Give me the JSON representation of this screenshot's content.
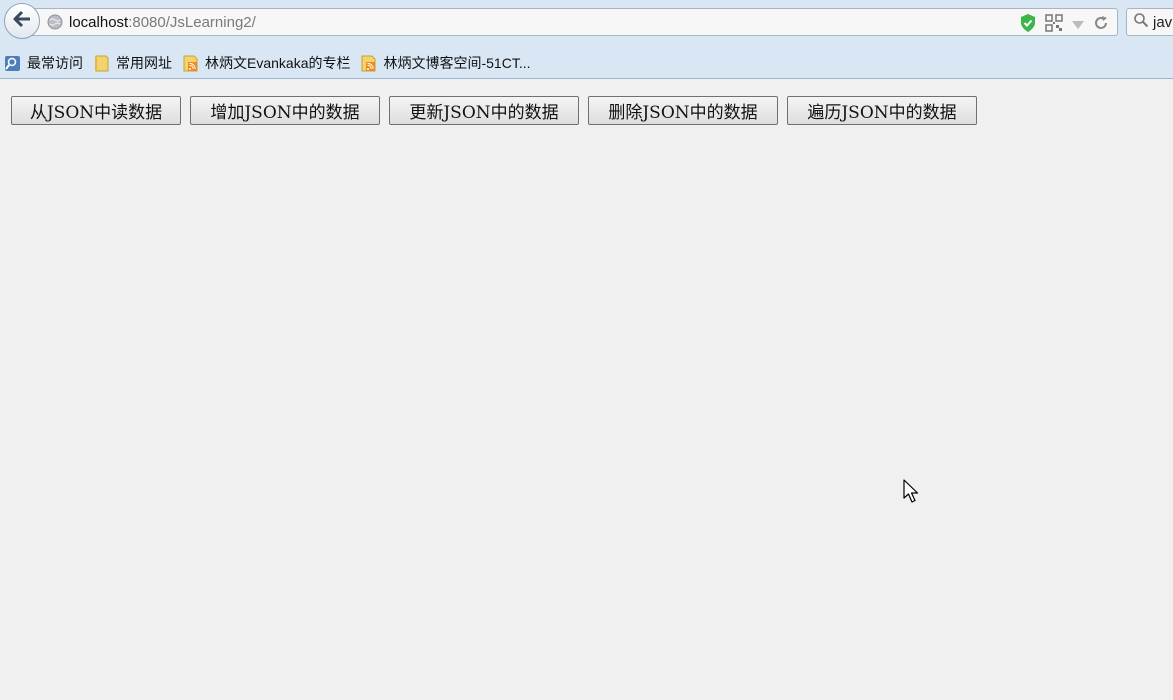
{
  "browser": {
    "url_host": "localhost",
    "url_rest": ":8080/JsLearning2/",
    "search_value": "jav"
  },
  "bookmarks": [
    {
      "label": "最常访问",
      "icon": "frequent-icon"
    },
    {
      "label": "常用网址",
      "icon": "folder-icon"
    },
    {
      "label": "林炳文Evankaka的专栏",
      "icon": "rss-feed-icon"
    },
    {
      "label": "林炳文博客空间-51CT...",
      "icon": "rss-feed-icon"
    }
  ],
  "buttons": {
    "read": "从JSON中读数据",
    "add": "增加JSON中的数据",
    "update": "更新JSON中的数据",
    "delete": "删除JSON中的数据",
    "iterate": "遍历JSON中的数据"
  },
  "colors": {
    "chrome_bg": "#d9e7f5",
    "page_bg": "#f0f0f0",
    "shield_green": "#3cb54a"
  }
}
